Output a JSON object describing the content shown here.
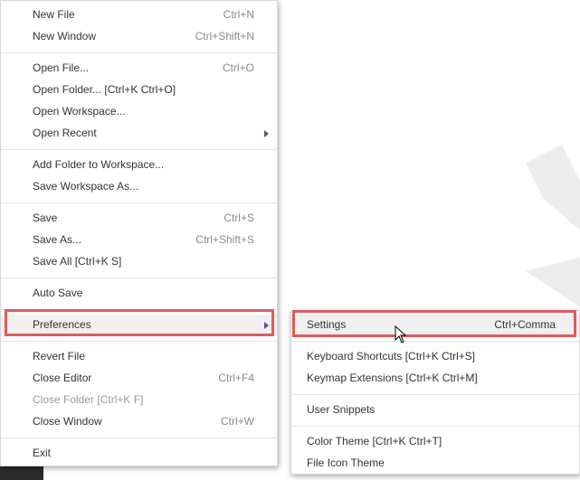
{
  "file_menu": {
    "items": [
      {
        "label": "New File",
        "shortcut": "Ctrl+N"
      },
      {
        "label": "New Window",
        "shortcut": "Ctrl+Shift+N"
      },
      {
        "label": "Open File...",
        "shortcut": "Ctrl+O"
      },
      {
        "label": "Open Folder... [Ctrl+K Ctrl+O]",
        "shortcut": ""
      },
      {
        "label": "Open Workspace...",
        "shortcut": ""
      },
      {
        "label": "Open Recent",
        "shortcut": ""
      },
      {
        "label": "Add Folder to Workspace...",
        "shortcut": ""
      },
      {
        "label": "Save Workspace As...",
        "shortcut": ""
      },
      {
        "label": "Save",
        "shortcut": "Ctrl+S"
      },
      {
        "label": "Save As...",
        "shortcut": "Ctrl+Shift+S"
      },
      {
        "label": "Save All [Ctrl+K S]",
        "shortcut": ""
      },
      {
        "label": "Auto Save",
        "shortcut": ""
      },
      {
        "label": "Preferences",
        "shortcut": ""
      },
      {
        "label": "Revert File",
        "shortcut": ""
      },
      {
        "label": "Close Editor",
        "shortcut": "Ctrl+F4"
      },
      {
        "label": "Close Folder [Ctrl+K F]",
        "shortcut": ""
      },
      {
        "label": "Close Window",
        "shortcut": "Ctrl+W"
      },
      {
        "label": "Exit",
        "shortcut": ""
      }
    ]
  },
  "preferences_menu": {
    "items": [
      {
        "label": "Settings",
        "shortcut": "Ctrl+Comma"
      },
      {
        "label": "Keyboard Shortcuts [Ctrl+K Ctrl+S]",
        "shortcut": ""
      },
      {
        "label": "Keymap Extensions [Ctrl+K Ctrl+M]",
        "shortcut": ""
      },
      {
        "label": "User Snippets",
        "shortcut": ""
      },
      {
        "label": "Color Theme [Ctrl+K Ctrl+T]",
        "shortcut": ""
      },
      {
        "label": "File Icon Theme",
        "shortcut": ""
      }
    ]
  },
  "colors": {
    "highlight_box": "#e25a5a",
    "submenu_arrow": "#6b4a8a"
  },
  "icons": {
    "submenu": "submenu-arrow-icon",
    "pointer": "mouse-pointer-icon"
  }
}
